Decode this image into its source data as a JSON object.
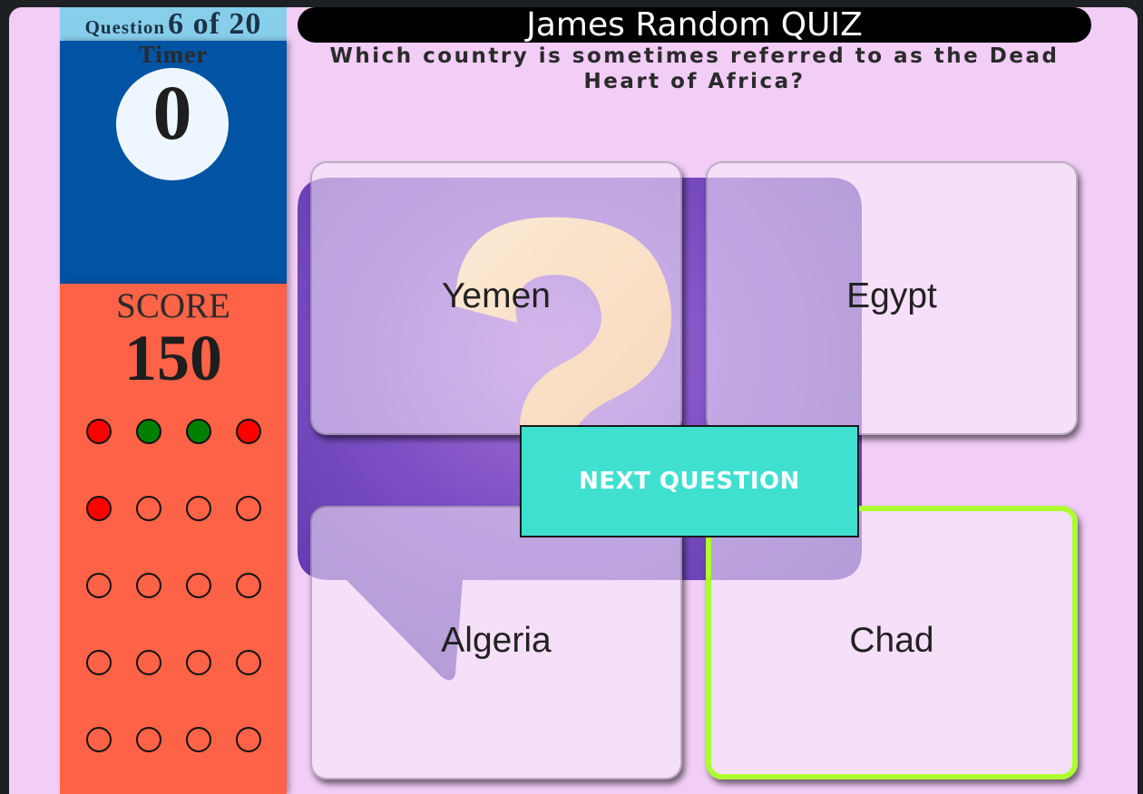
{
  "question_counter": {
    "label": "Question",
    "value": "6 of 20"
  },
  "timer": {
    "label": "Timer",
    "value": "0"
  },
  "score": {
    "label": "SCORE",
    "value": "150"
  },
  "progress": [
    "wrong",
    "right",
    "right",
    "wrong",
    "wrong",
    "unanswered",
    "unanswered",
    "unanswered",
    "unanswered",
    "unanswered",
    "unanswered",
    "unanswered",
    "unanswered",
    "unanswered",
    "unanswered",
    "unanswered",
    "unanswered",
    "unanswered",
    "unanswered",
    "unanswered"
  ],
  "header": {
    "title": "James Random QUIZ"
  },
  "question": {
    "text": "Which country is sometimes referred to as the Dead Heart of Africa?"
  },
  "answers": [
    {
      "label": "Yemen",
      "selected": false
    },
    {
      "label": "Egypt",
      "selected": false
    },
    {
      "label": "Algeria",
      "selected": false
    },
    {
      "label": "Chad",
      "selected": true
    }
  ],
  "next_button": {
    "label": "NEXT QUESTION"
  },
  "colors": {
    "page_bg": "#f2cdf6",
    "timer_panel": "#0153a3",
    "score_panel": "#fe6347",
    "counter_bg": "#87ceeb",
    "next_button": "#40e0d0",
    "selected_border": "#adff2f",
    "dot_wrong": "#ff0000",
    "dot_right": "#008000"
  },
  "icons": {
    "background_art": "question-mark-speech-bubble-icon"
  }
}
